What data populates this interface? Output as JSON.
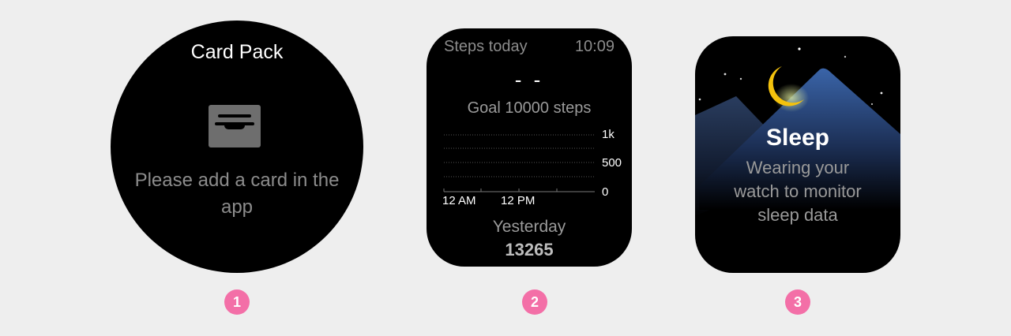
{
  "card_pack": {
    "title": "Card Pack",
    "message": "Please add a card in the app",
    "icon": "card-holder-icon"
  },
  "steps": {
    "title": "Steps today",
    "time": "10:09",
    "current": "- -",
    "goal": "Goal 10000 steps",
    "yesterday_label": "Yesterday",
    "yesterday_value": "13265",
    "chart_data": {
      "type": "bar",
      "x_tick_labels": [
        "12 AM",
        "12 PM"
      ],
      "y_tick_labels": [
        "1k",
        "500",
        "0"
      ],
      "ylim": [
        0,
        1000
      ],
      "values": []
    }
  },
  "sleep": {
    "title": "Sleep",
    "subtitle_lines": [
      "Wearing your",
      "watch to monitor",
      "sleep data"
    ],
    "icon": "moon-icon"
  },
  "badges": [
    "1",
    "2",
    "3"
  ],
  "colors": {
    "background": "#eeeeee",
    "screen": "#000000",
    "badge": "#f36fa7",
    "moon": "#f4c20d",
    "mountain": "#2e4f86"
  }
}
